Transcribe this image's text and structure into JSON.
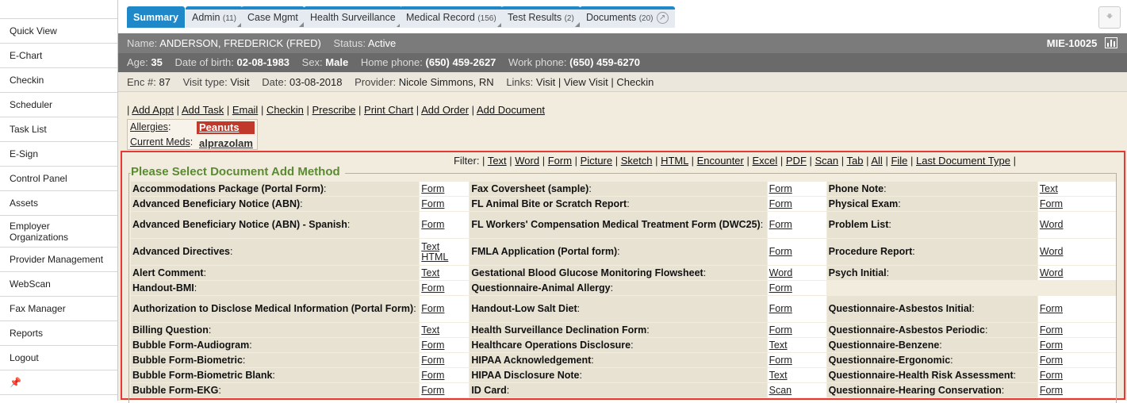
{
  "sidebar": {
    "items": [
      "Quick View",
      "E-Chart",
      "Checkin",
      "Scheduler",
      "Task List",
      "E-Sign",
      "Control Panel",
      "Assets",
      "Employer Organizations",
      "Provider Management",
      "WebScan",
      "Fax Manager",
      "Reports",
      "Logout"
    ]
  },
  "tabs": [
    {
      "label": "Summary",
      "count": ""
    },
    {
      "label": "Admin",
      "count": "(11)"
    },
    {
      "label": "Case Mgmt",
      "count": ""
    },
    {
      "label": "Health Surveillance",
      "count": ""
    },
    {
      "label": "Medical Record",
      "count": "(156)"
    },
    {
      "label": "Test Results",
      "count": "(2)"
    },
    {
      "label": "Documents",
      "count": "(20)"
    }
  ],
  "header": {
    "name_label": "Name:",
    "name": "ANDERSON, FREDERICK (FRED)",
    "status_label": "Status:",
    "status": "Active",
    "mrn": "MIE-10025",
    "age_label": "Age:",
    "age": "35",
    "dob_label": "Date of birth:",
    "dob": "02-08-1983",
    "sex_label": "Sex:",
    "sex": "Male",
    "home_label": "Home phone:",
    "home": "(650) 459-2627",
    "work_label": "Work phone:",
    "work": "(650) 459-6270",
    "enc_label": "Enc #:",
    "enc": "87",
    "visit_label": "Visit type:",
    "visit": "Visit",
    "date_label": "Date:",
    "date": "03-08-2018",
    "provider_label": "Provider:",
    "provider": "Nicole Simmons, RN",
    "links_label": "Links:",
    "links": [
      "Visit",
      "View Visit",
      "Checkin"
    ]
  },
  "actions": [
    "Add Appt",
    "Add Task",
    "Email",
    "Checkin",
    "Prescribe",
    "Print Chart",
    "Add Order",
    "Add Document"
  ],
  "allergy": {
    "allergies_label": "Allergies",
    "allergy": "Peanuts",
    "meds_label": "Current Meds",
    "med": "alprazolam"
  },
  "filter": {
    "label": "Filter:",
    "options": [
      "Text",
      "Word",
      "Form",
      "Picture",
      "Sketch",
      "HTML",
      "Encounter",
      "Excel",
      "PDF",
      "Scan",
      "Tab",
      "All",
      "File",
      "Last Document Type"
    ]
  },
  "panel_title": "Please Select Document Add Method",
  "doc_rows": [
    {
      "tall": false,
      "cells": [
        [
          "Accommodations Package (Portal Form)",
          [
            "Form"
          ]
        ],
        [
          "Fax Coversheet (sample)",
          [
            "Form"
          ]
        ],
        [
          "Phone Note",
          [
            "Text"
          ]
        ]
      ]
    },
    {
      "tall": false,
      "cells": [
        [
          "Advanced Beneficiary Notice (ABN)",
          [
            "Form"
          ]
        ],
        [
          "FL Animal Bite or Scratch Report",
          [
            "Form"
          ]
        ],
        [
          "Physical Exam",
          [
            "Form"
          ]
        ]
      ]
    },
    {
      "tall": true,
      "cells": [
        [
          "Advanced Beneficiary Notice (ABN) - Spanish",
          [
            "Form"
          ]
        ],
        [
          "FL Workers' Compensation Medical Treatment Form (DWC25)",
          [
            "Form"
          ]
        ],
        [
          "Problem List",
          [
            "Word"
          ]
        ]
      ]
    },
    {
      "tall": true,
      "cells": [
        [
          "Advanced Directives",
          [
            "Text",
            "HTML"
          ]
        ],
        [
          "FMLA Application (Portal form)",
          [
            "Form"
          ]
        ],
        [
          "Procedure Report",
          [
            "Word"
          ]
        ]
      ]
    },
    {
      "tall": false,
      "cells": [
        [
          "Alert Comment",
          [
            "Text"
          ]
        ],
        [
          "Gestational Blood Glucose Monitoring Flowsheet",
          [
            "Word"
          ]
        ],
        [
          "Psych Initial",
          [
            "Word"
          ]
        ]
      ]
    },
    {
      "tall": false,
      "cells": [
        [
          "Handout-BMI",
          [
            "Form"
          ]
        ],
        [
          "Questionnaire-Animal Allergy",
          [
            "Form"
          ]
        ],
        null
      ]
    },
    {
      "tall": true,
      "cells": [
        [
          "Authorization to Disclose Medical Information (Portal Form)",
          [
            "Form"
          ]
        ],
        [
          "Handout-Low Salt Diet",
          [
            "Form"
          ]
        ],
        [
          "Questionnaire-Asbestos Initial",
          [
            "Form"
          ]
        ]
      ]
    },
    {
      "tall": false,
      "cells": [
        [
          "Billing Question",
          [
            "Text"
          ]
        ],
        [
          "Health Surveillance Declination Form",
          [
            "Form"
          ]
        ],
        [
          "Questionnaire-Asbestos Periodic",
          [
            "Form"
          ]
        ]
      ]
    },
    {
      "tall": false,
      "cells": [
        [
          "Bubble Form-Audiogram",
          [
            "Form"
          ]
        ],
        [
          "Healthcare Operations Disclosure",
          [
            "Text"
          ]
        ],
        [
          "Questionnaire-Benzene",
          [
            "Form"
          ]
        ]
      ]
    },
    {
      "tall": false,
      "cells": [
        [
          "Bubble Form-Biometric",
          [
            "Form"
          ]
        ],
        [
          "HIPAA Acknowledgement",
          [
            "Form"
          ]
        ],
        [
          "Questionnaire-Ergonomic",
          [
            "Form"
          ]
        ]
      ]
    },
    {
      "tall": false,
      "cells": [
        [
          "Bubble Form-Biometric Blank",
          [
            "Form"
          ]
        ],
        [
          "HIPAA Disclosure Note",
          [
            "Text"
          ]
        ],
        [
          "Questionnaire-Health Risk Assessment",
          [
            "Form"
          ]
        ]
      ]
    },
    {
      "tall": false,
      "cells": [
        [
          "Bubble Form-EKG",
          [
            "Form"
          ]
        ],
        [
          "ID Card",
          [
            "Scan"
          ]
        ],
        [
          "Questionnaire-Hearing Conservation",
          [
            "Form"
          ]
        ]
      ]
    }
  ],
  "colors": {
    "accent": "#1e88c8",
    "highlight": "#e53935",
    "allergy": "#c0392b",
    "legend": "#5a8a32"
  }
}
